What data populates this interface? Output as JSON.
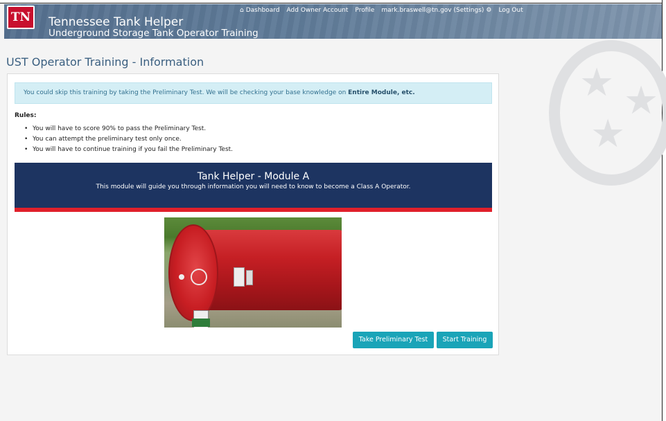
{
  "header": {
    "logo_text": "TN",
    "title": "Tennessee Tank Helper",
    "subtitle": "Underground Storage Tank Operator Training",
    "nav": {
      "dashboard": "Dashboard",
      "add_owner_account": "Add Owner Account",
      "profile": "Profile",
      "user_settings": "mark.braswell@tn.gov (Settings)",
      "logout": "Log Out"
    }
  },
  "page": {
    "title": "UST Operator Training - Information"
  },
  "alert": {
    "text": "You could skip this training by taking the Preliminary Test. We will be checking your base knowledge on ",
    "emphasis": "Entire Module, etc."
  },
  "rules": {
    "label": "Rules:",
    "items": [
      "You will have to score 90% to pass the Preliminary Test.",
      "You can attempt the preliminary test only once.",
      "You will have to continue training if you fail the Preliminary Test."
    ]
  },
  "module": {
    "title": "Tank Helper - Module A",
    "description": "This module will guide you through information you will need to know to become a Class A Operator."
  },
  "buttons": {
    "preliminary_test": "Take Preliminary Test",
    "start_training": "Start Training"
  },
  "colors": {
    "header_bg": "#5f7b98",
    "logo_red": "#c8102e",
    "banner_navy": "#1d3461",
    "banner_stripe": "#e0202b",
    "button_teal": "#1aa4b8",
    "alert_bg": "#d4eef5"
  },
  "icons": {
    "dashboard": "home-icon",
    "settings": "gear-icon",
    "seal": "tennessee-tristar-seal"
  }
}
